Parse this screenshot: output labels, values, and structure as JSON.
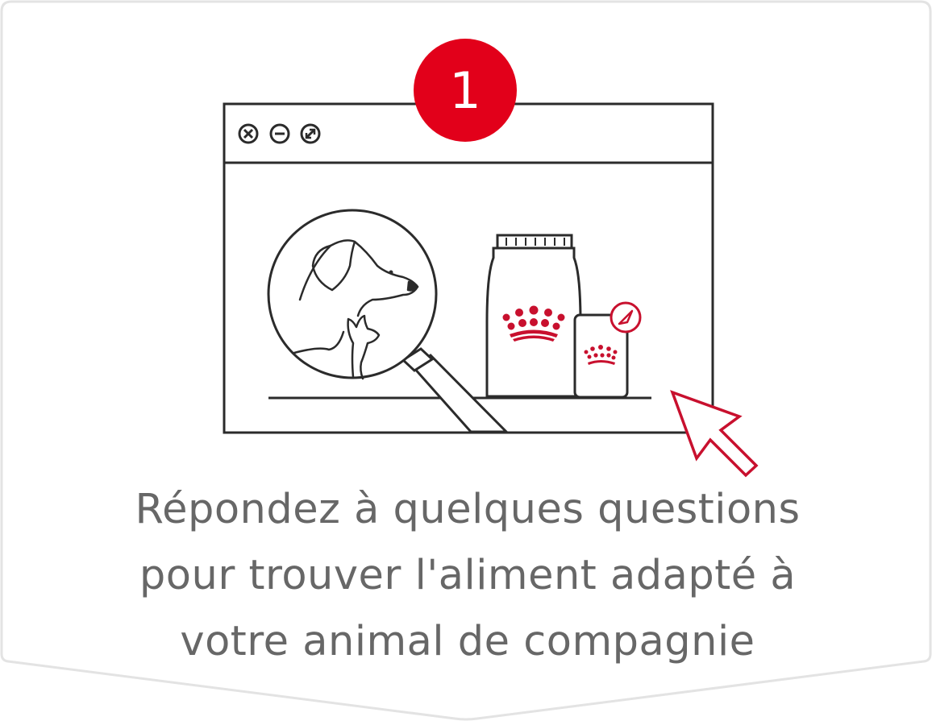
{
  "step": {
    "number": "1"
  },
  "caption": {
    "line1": "Répondez à quelques questions",
    "line2": "pour trouver l'aliment adapté à",
    "line3": "votre animal de compagnie"
  },
  "colors": {
    "accent": "#e2001a",
    "stroke": "#2b2b2b",
    "caption_text": "#676767",
    "card_border": "#e3e3e3"
  },
  "icons": [
    "close-window-icon",
    "minimize-window-icon",
    "maximize-window-icon",
    "magnifying-glass-icon",
    "dog-icon",
    "cat-icon",
    "food-bag-icon",
    "crown-logo-icon",
    "food-pouch-icon",
    "cursor-arrow-icon"
  ]
}
